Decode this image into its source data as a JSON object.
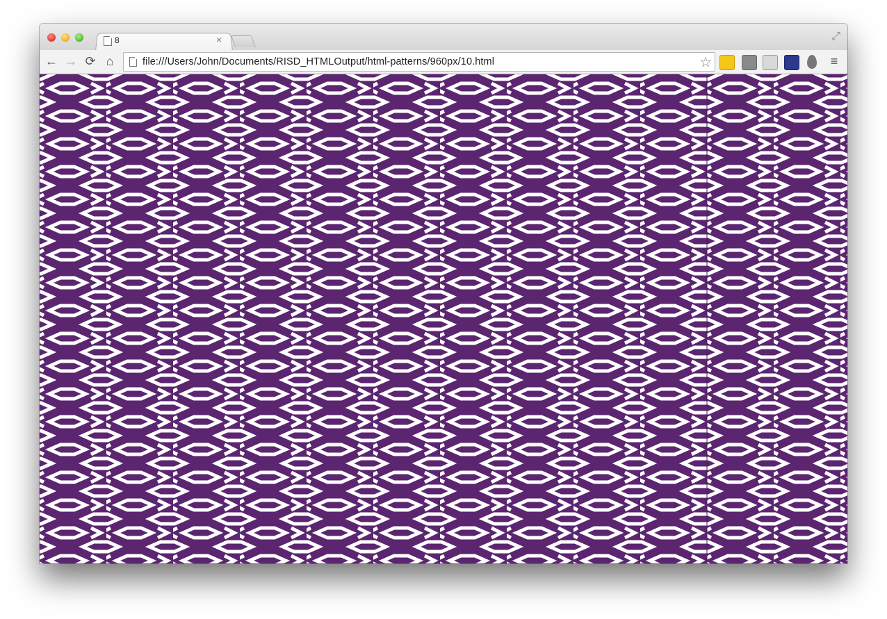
{
  "browser": {
    "tab": {
      "title": "8"
    },
    "address_bar": {
      "url": "file:///Users/John/Documents/RISD_HTMLOutput/html-patterns/960px/10.html"
    }
  },
  "page": {
    "background_color": "#5b2570",
    "pattern_color": "#ffffff"
  }
}
